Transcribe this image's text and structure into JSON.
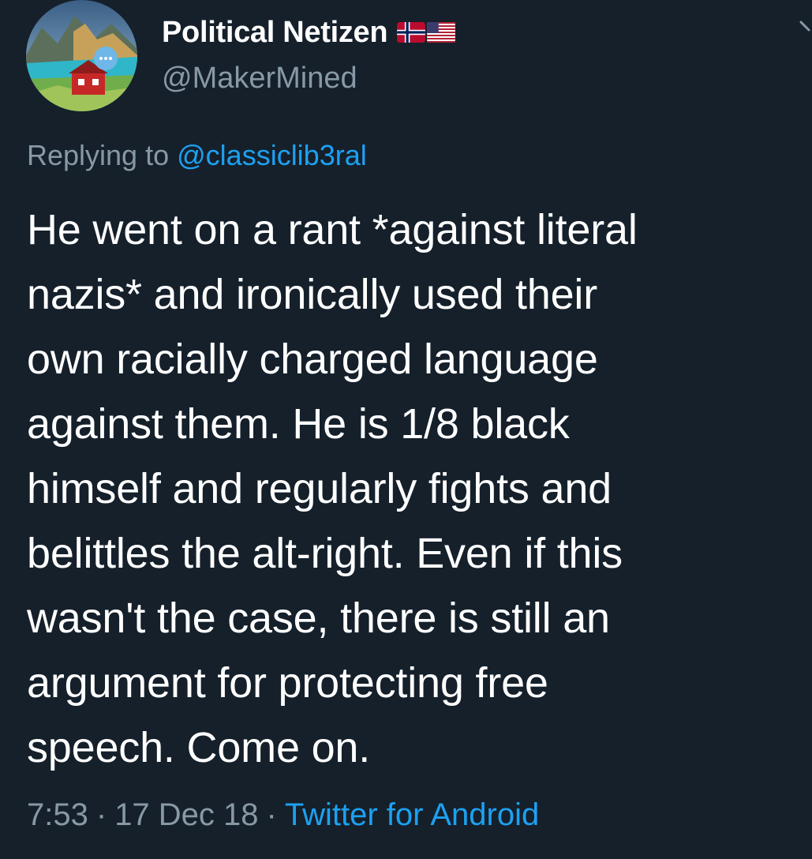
{
  "user": {
    "display_name": "Political Netizen",
    "handle": "@MakerMined",
    "flags": [
      "norway-flag",
      "usa-flag"
    ]
  },
  "reply": {
    "prefix": "Replying to",
    "mention": "@classiclib3ral"
  },
  "tweet": {
    "lines": [
      "He went on a rant *against literal",
      "nazis* and ironically used their",
      "own racially charged language",
      "against them. He is 1/8 black",
      "himself and regularly fights and",
      "belittles the alt-right. Even if this",
      "wasn't the case, there is still an",
      "argument for protecting free",
      "speech. Come on."
    ]
  },
  "meta": {
    "time": "7:53",
    "date": "17 Dec 18",
    "separator": "·",
    "source": "Twitter for Android"
  },
  "colors": {
    "background": "#15202b",
    "text": "#ffffff",
    "secondary": "#8899a6",
    "accent": "#1da1f2"
  },
  "icons": {
    "menu": "chevron-down-icon"
  }
}
